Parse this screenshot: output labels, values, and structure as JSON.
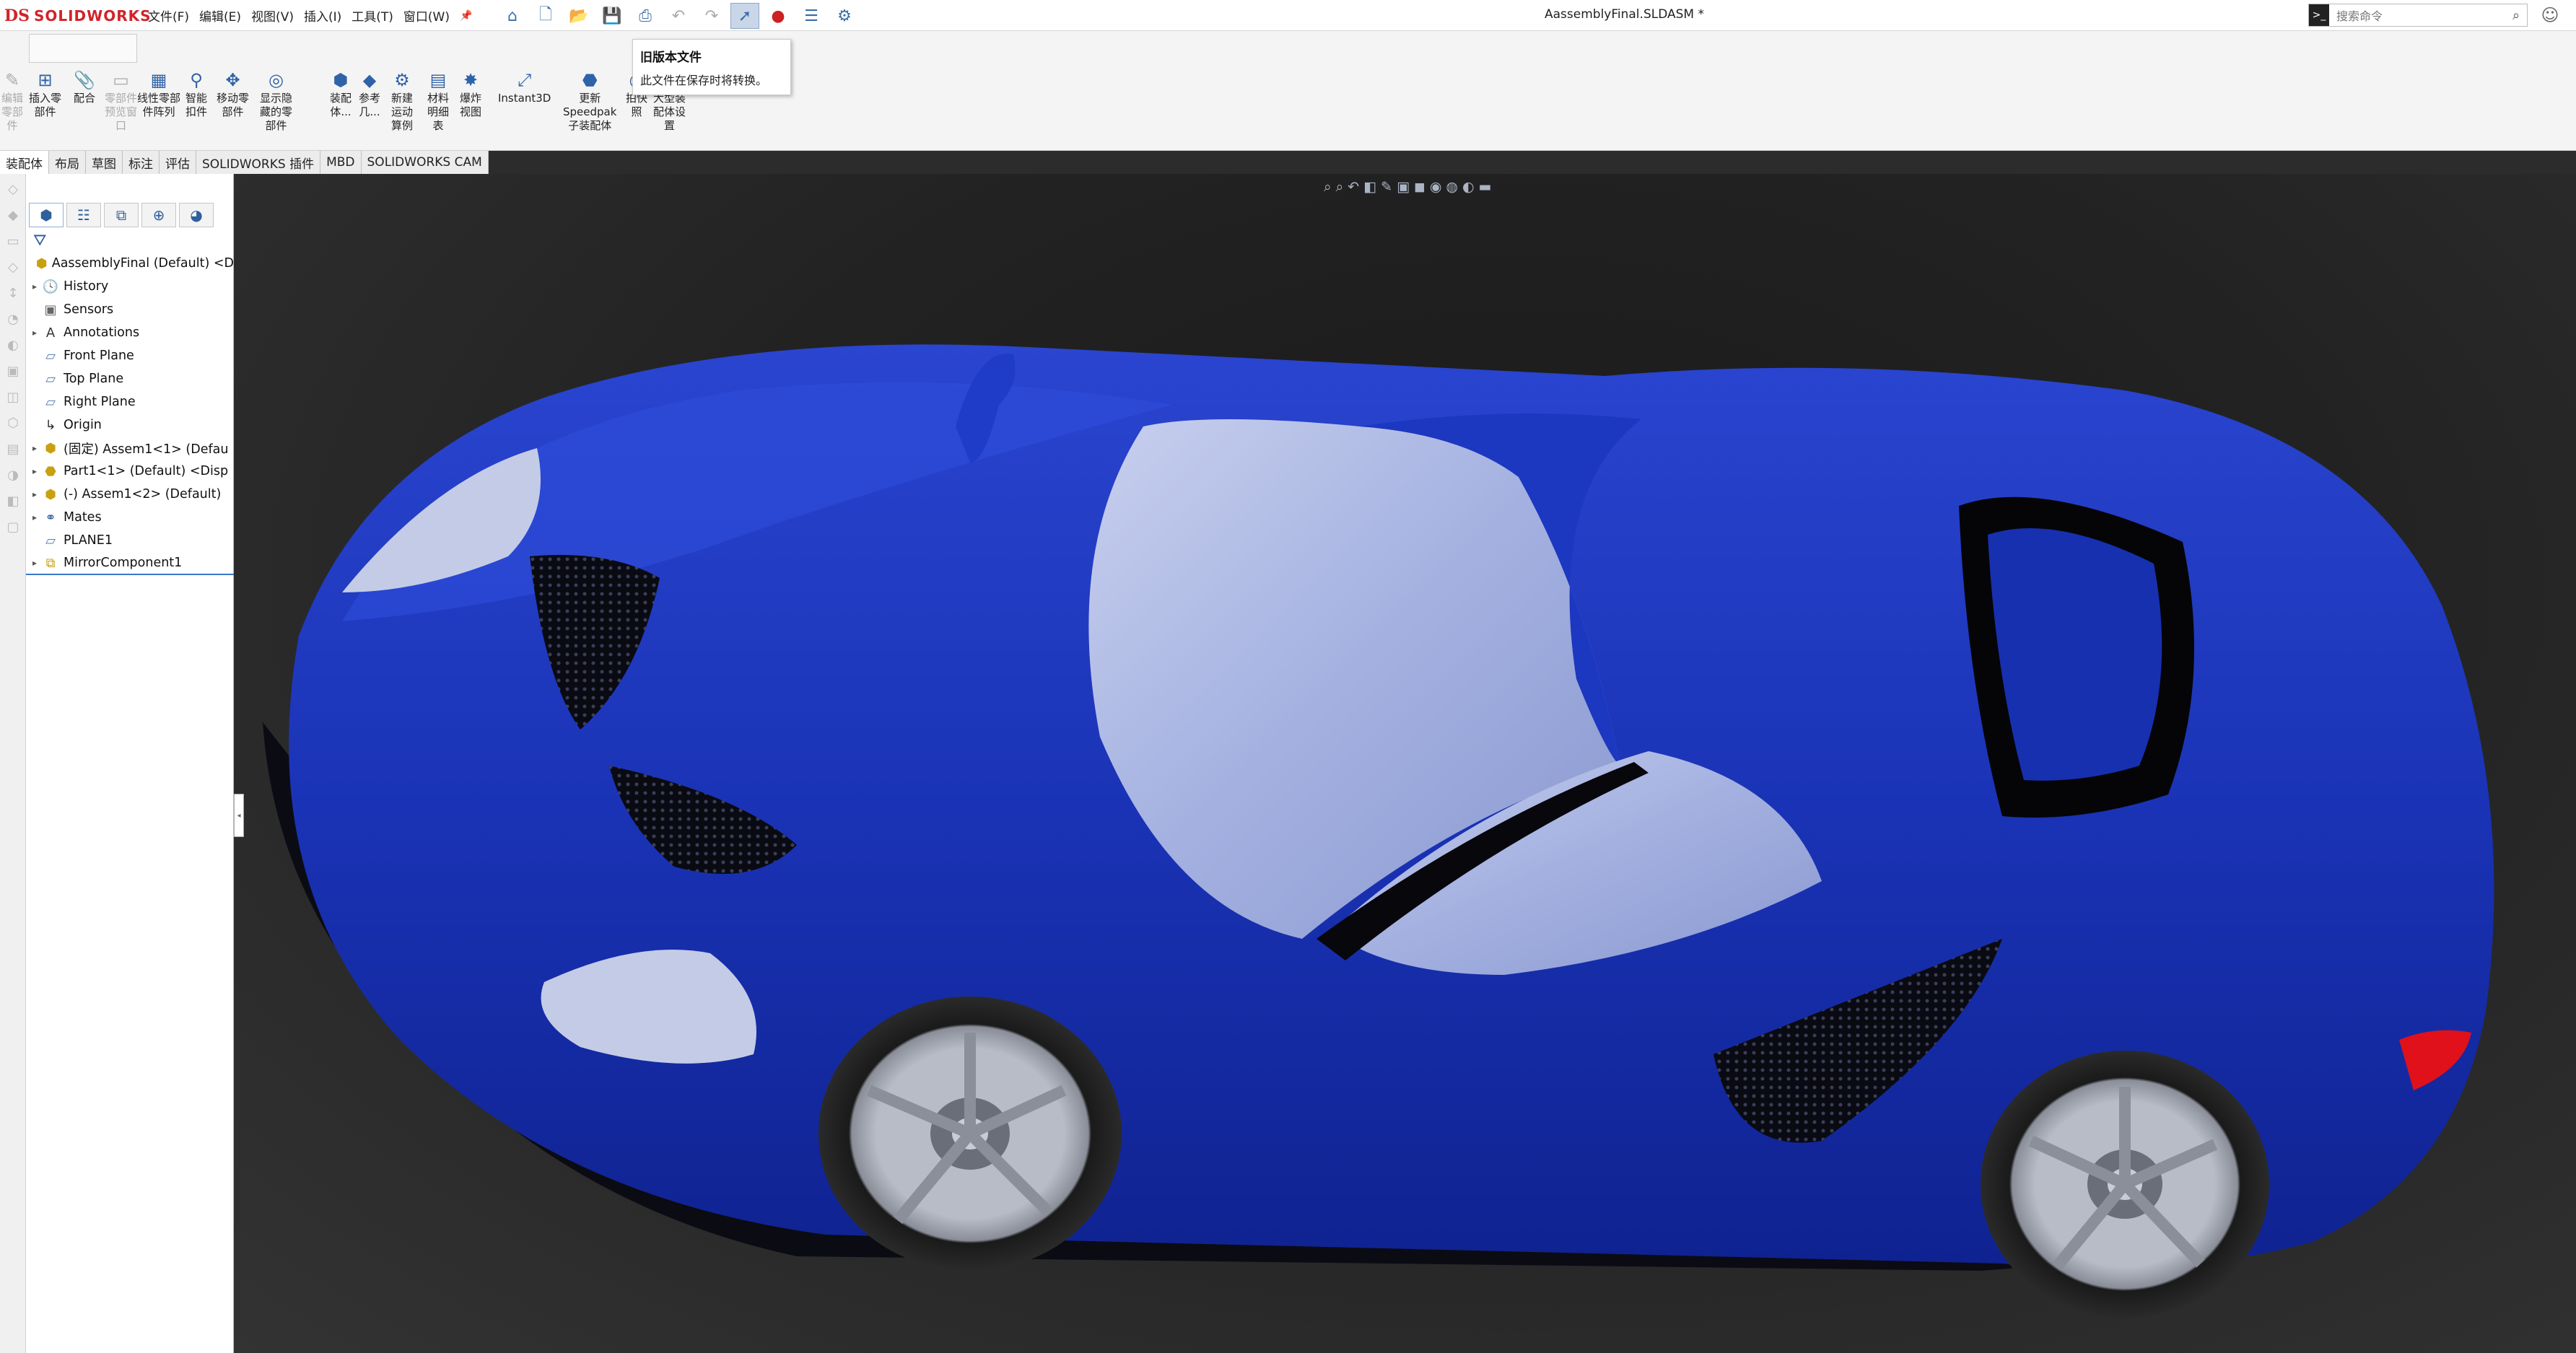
{
  "app": {
    "logo_mark": "DS",
    "logo_text": "SOLIDWORKS",
    "document_title": "AassemblyFinal.SLDASM *"
  },
  "menu": [
    "文件(F)",
    "编辑(E)",
    "视图(V)",
    "插入(I)",
    "工具(T)",
    "窗口(W)"
  ],
  "search": {
    "placeholder": "搜索命令"
  },
  "tooltip": {
    "title": "旧版本文件",
    "body": "此文件在保存时将转换。"
  },
  "ribbon": [
    {
      "label": "编辑\n零部\n件",
      "icon": "edit-component-icon",
      "disabled": true
    },
    {
      "label": "插入零\n部件",
      "icon": "insert-component-icon",
      "disabled": false
    },
    {
      "label": "配合",
      "icon": "mate-icon",
      "disabled": false
    },
    {
      "label": "零部件\n预览窗\n口",
      "icon": "component-preview-icon",
      "disabled": true
    },
    {
      "label": "线性零部\n件阵列",
      "icon": "linear-pattern-icon",
      "disabled": false
    },
    {
      "label": "智能\n扣件",
      "icon": "smart-fastener-icon",
      "disabled": false
    },
    {
      "label": "移动零\n部件",
      "icon": "move-component-icon",
      "disabled": false
    },
    {
      "label": "显示隐\n藏的零\n部件",
      "icon": "show-hidden-icon",
      "disabled": false
    },
    {
      "label": "装配\n体...",
      "icon": "assembly-features-icon",
      "disabled": false
    },
    {
      "label": "参考\n几...",
      "icon": "reference-geometry-icon",
      "disabled": false
    },
    {
      "label": "新建\n运动\n算例",
      "icon": "new-motion-study-icon",
      "disabled": false
    },
    {
      "label": "材料\n明细\n表",
      "icon": "bom-icon",
      "disabled": false
    },
    {
      "label": "爆炸\n视图",
      "icon": "exploded-view-icon",
      "disabled": false
    },
    {
      "label": "Instant3D",
      "icon": "instant3d-icon",
      "disabled": false
    },
    {
      "label": "更新\nSpeedpak\n子装配体",
      "icon": "speedpak-icon",
      "disabled": false
    },
    {
      "label": "拍快\n照",
      "icon": "snapshot-icon",
      "disabled": false
    },
    {
      "label": "大型装\n配体设\n置",
      "icon": "large-assembly-icon",
      "disabled": false
    }
  ],
  "tabs": [
    "装配体",
    "布局",
    "草图",
    "标注",
    "评估",
    "SOLIDWORKS 插件",
    "MBD",
    "SOLIDWORKS CAM"
  ],
  "tree": [
    {
      "label": "AassemblyFinal (Default) <D",
      "icon": "assembly-icon",
      "expander": "",
      "level": "root"
    },
    {
      "label": "History",
      "icon": "history-icon",
      "expander": "▸"
    },
    {
      "label": "Sensors",
      "icon": "sensors-icon",
      "expander": ""
    },
    {
      "label": "Annotations",
      "icon": "annotations-icon",
      "expander": "▸"
    },
    {
      "label": "Front Plane",
      "icon": "plane-icon",
      "expander": ""
    },
    {
      "label": "Top Plane",
      "icon": "plane-icon",
      "expander": ""
    },
    {
      "label": "Right Plane",
      "icon": "plane-icon",
      "expander": ""
    },
    {
      "label": "Origin",
      "icon": "origin-icon",
      "expander": ""
    },
    {
      "label": "(固定) Assem1<1> (Defau",
      "icon": "subassembly-icon",
      "expander": "▸"
    },
    {
      "label": "Part1<1> (Default) <Disp",
      "icon": "part-icon",
      "expander": "▸"
    },
    {
      "label": "(-) Assem1<2> (Default)",
      "icon": "subassembly-icon",
      "expander": "▸"
    },
    {
      "label": "Mates",
      "icon": "mates-icon",
      "expander": "▸"
    },
    {
      "label": "PLANE1",
      "icon": "plane-icon",
      "expander": ""
    },
    {
      "label": "MirrorComponent1",
      "icon": "mirror-component-icon",
      "expander": "▸"
    }
  ],
  "colors": {
    "brand": "#d2232a",
    "car_body": "#1a35b4",
    "viewport_bg": "#222222"
  }
}
